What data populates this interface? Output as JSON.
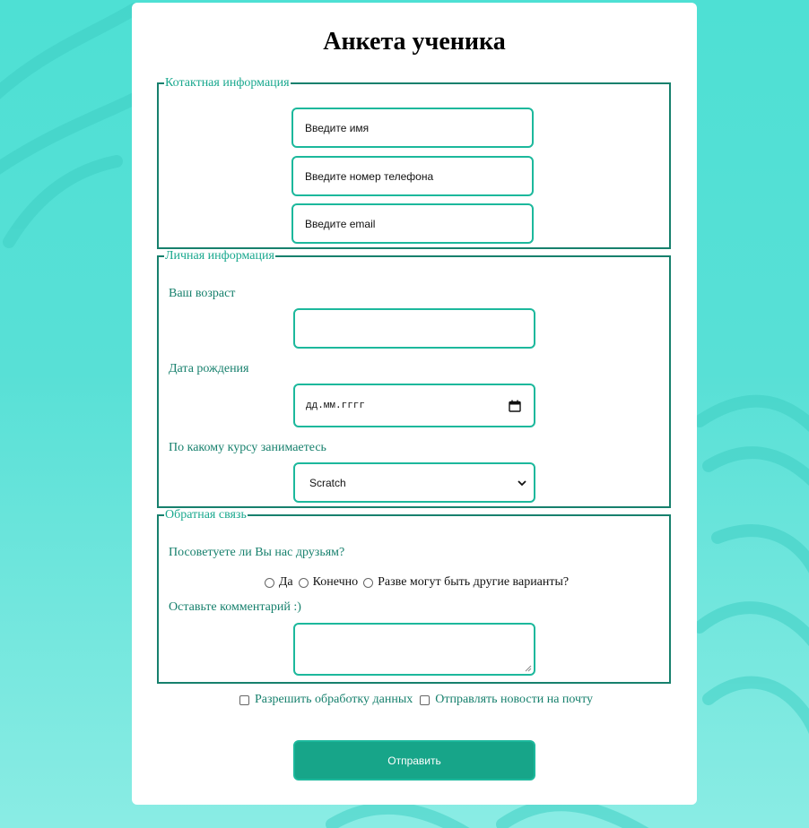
{
  "form": {
    "title": "Анкета ученика",
    "contact": {
      "legend": "Котактная информация",
      "name_placeholder": "Введите имя",
      "phone_placeholder": "Введите номер телефона",
      "email_placeholder": "Введите email"
    },
    "personal": {
      "legend": "Личная информация",
      "age_label": "Ваш возраст",
      "age_value": "",
      "birth_label": "Дата рождения",
      "birth_placeholder": "дд.мм.гггг",
      "course_label": "По какому курсу занимаетесь",
      "course_selected": "Scratch"
    },
    "feedback": {
      "legend": "Обратная связь",
      "recommend_label": "Посоветуете ли Вы нас друзьям?",
      "options": [
        "Да",
        "Конечно",
        "Разве могут быть другие варианты?"
      ],
      "comment_label": "Оставьте комментарий :)",
      "comment_value": ""
    },
    "consent": {
      "allow_processing": "Разрешить обработку данных",
      "send_news": "Отправлять новости на почту"
    },
    "submit_label": "Отправить"
  },
  "colors": {
    "accent": "#1cb89c",
    "border_dark": "#17806d",
    "legend_text": "#19a88e",
    "button_bg": "#17a589",
    "background_top": "#4ee0d4",
    "background_bottom": "#8aece4"
  },
  "icons": {
    "date_picker": "calendar-icon",
    "select": "chevron-down-icon"
  }
}
